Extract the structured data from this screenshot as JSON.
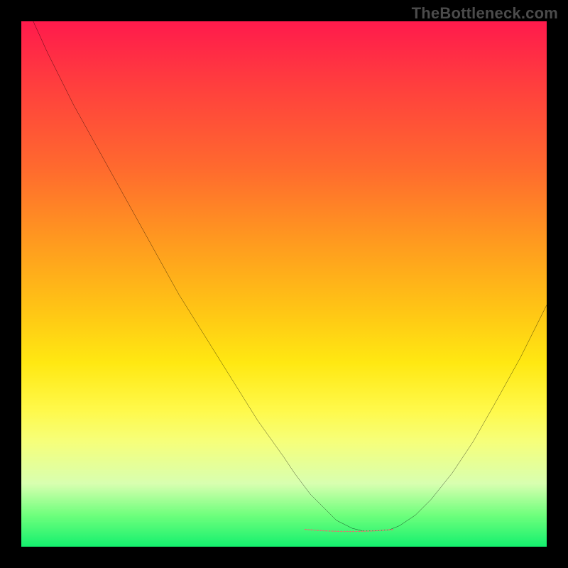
{
  "watermark": "TheBottleneck.com",
  "colors": {
    "background": "#000000",
    "curve": "#000000",
    "highlight": "#e86f6f",
    "watermark": "#4b4b4b"
  },
  "chart_data": {
    "type": "line",
    "title": "",
    "xlabel": "",
    "ylabel": "",
    "xlim": [
      0,
      100
    ],
    "ylim": [
      0,
      100
    ],
    "grid": false,
    "legend": false,
    "series": [
      {
        "name": "bottleneck-curve",
        "x": [
          0,
          5,
          10,
          15,
          20,
          25,
          30,
          35,
          40,
          45,
          50,
          52,
          55,
          58,
          60,
          63,
          65,
          67,
          70,
          72,
          75,
          78,
          82,
          86,
          90,
          95,
          100
        ],
        "y": [
          105,
          94,
          84,
          75,
          66,
          57,
          48,
          40,
          32,
          24,
          17,
          14,
          10,
          7,
          5,
          3.5,
          3,
          3,
          3.2,
          4,
          6,
          9,
          14,
          20,
          27,
          36,
          46
        ]
      }
    ],
    "annotations": [
      {
        "name": "highlight-flat-min",
        "type": "segment",
        "x": [
          54,
          71
        ],
        "y": [
          3.3,
          3.3
        ],
        "style": "dashed-thick",
        "color": "#e86f6f"
      }
    ]
  }
}
